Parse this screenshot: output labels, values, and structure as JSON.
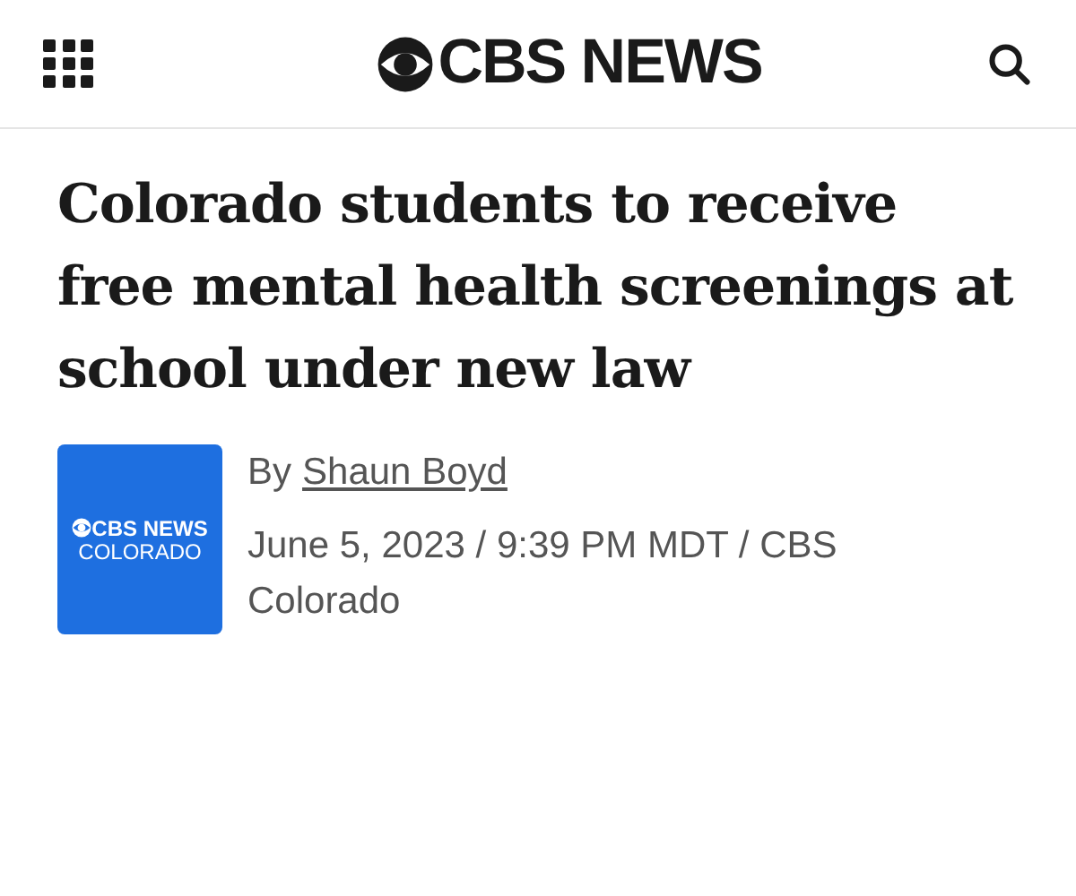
{
  "header": {
    "brand": "CBS NEWS"
  },
  "headline": "Colorado students to receive free mental health screenings at school under new law",
  "byline": {
    "prefix": "By",
    "author": "Shaun Boyd",
    "meta": "June 5, 2023 / 9:39 PM MDT / CBS Colorado"
  },
  "station_logo": {
    "line_1": "CBS NEWS",
    "line_2": "COLORADO"
  }
}
